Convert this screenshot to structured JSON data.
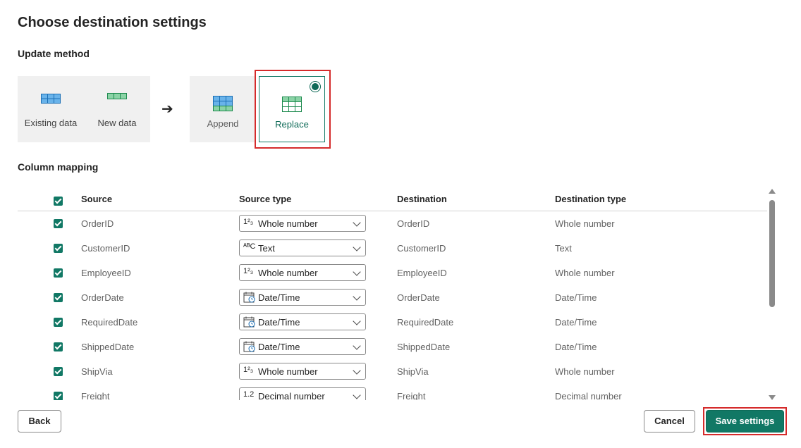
{
  "dialog": {
    "title": "Choose destination settings"
  },
  "update_method": {
    "label": "Update method",
    "existing_data_label": "Existing data",
    "new_data_label": "New data",
    "options": [
      {
        "label": "Append",
        "selected": false
      },
      {
        "label": "Replace",
        "selected": true
      }
    ]
  },
  "column_mapping": {
    "label": "Column mapping",
    "headers": {
      "source": "Source",
      "source_type": "Source type",
      "destination": "Destination",
      "destination_type": "Destination type"
    },
    "all_checked": true,
    "rows": [
      {
        "checked": true,
        "source": "OrderID",
        "type_icon": "whole-number",
        "type_icon_text": "1²₃",
        "source_type": "Whole number",
        "destination": "OrderID",
        "destination_type": "Whole number"
      },
      {
        "checked": true,
        "source": "CustomerID",
        "type_icon": "text",
        "type_icon_text": "ᴬᴮC",
        "source_type": "Text",
        "destination": "CustomerID",
        "destination_type": "Text"
      },
      {
        "checked": true,
        "source": "EmployeeID",
        "type_icon": "whole-number",
        "type_icon_text": "1²₃",
        "source_type": "Whole number",
        "destination": "EmployeeID",
        "destination_type": "Whole number"
      },
      {
        "checked": true,
        "source": "OrderDate",
        "type_icon": "datetime",
        "type_icon_text": "",
        "source_type": "Date/Time",
        "destination": "OrderDate",
        "destination_type": "Date/Time"
      },
      {
        "checked": true,
        "source": "RequiredDate",
        "type_icon": "datetime",
        "type_icon_text": "",
        "source_type": "Date/Time",
        "destination": "RequiredDate",
        "destination_type": "Date/Time"
      },
      {
        "checked": true,
        "source": "ShippedDate",
        "type_icon": "datetime",
        "type_icon_text": "",
        "source_type": "Date/Time",
        "destination": "ShippedDate",
        "destination_type": "Date/Time"
      },
      {
        "checked": true,
        "source": "ShipVia",
        "type_icon": "whole-number",
        "type_icon_text": "1²₃",
        "source_type": "Whole number",
        "destination": "ShipVia",
        "destination_type": "Whole number"
      },
      {
        "checked": true,
        "source": "Freight",
        "type_icon": "decimal-number",
        "type_icon_text": "1.2",
        "source_type": "Decimal number",
        "destination": "Freight",
        "destination_type": "Decimal number"
      }
    ]
  },
  "footer": {
    "back_label": "Back",
    "cancel_label": "Cancel",
    "save_label": "Save settings"
  },
  "colors": {
    "accent": "#117865",
    "highlight": "#d52b2b"
  }
}
